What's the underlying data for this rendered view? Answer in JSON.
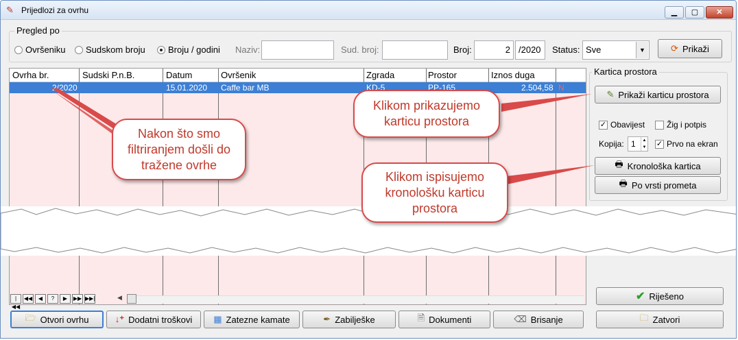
{
  "window": {
    "title": "Prijedlozi za ovrhu",
    "min_label": "▁",
    "max_label": "▢",
    "close_label": "✕"
  },
  "filter": {
    "legend": "Pregled po",
    "radios": [
      {
        "label": "Ovršeniku",
        "selected": false
      },
      {
        "label": "Sudskom broju",
        "selected": false
      },
      {
        "label": "Broju / godini",
        "selected": true
      }
    ],
    "naziv_label": "Naziv:",
    "naziv_value": "",
    "sud_broj_label": "Sud. broj:",
    "sud_broj_value": "",
    "broj_label": "Broj:",
    "broj_value": "2",
    "godina_value": "/2020",
    "status_label": "Status:",
    "status_value": "Sve",
    "prikazi_label": "Prikaži"
  },
  "grid": {
    "columns": [
      "Ovrha br.",
      "Sudski P.n.B.",
      "Datum",
      "Ovršenik",
      "Zgrada",
      "Prostor",
      "Iznos duga"
    ],
    "rows": [
      {
        "ovrha": "2/2020",
        "sudski": "",
        "datum": "15.01.2020",
        "ovrsenik": "Caffe bar  MB",
        "zgrada": "KD-5",
        "prostor": "PP-165",
        "iznos": "2.504,58",
        "flag": "N"
      }
    ]
  },
  "kartica": {
    "legend": "Kartica prostora",
    "prikazi_karticu_label": "Prikaži karticu prostora",
    "obavijest_label": "Obavijest",
    "obavijest_checked": true,
    "zig_label": "Žig i potpis",
    "zig_checked": false,
    "kopija_label": "Kopija:",
    "kopija_value": "1",
    "prvo_label": "Prvo na ekran",
    "prvo_checked": true,
    "kronoloska_label": "Kronološka kartica",
    "po_vrsti_label": "Po vrsti prometa"
  },
  "bottom": {
    "rijeseno_label": "Riješeno",
    "zatvori_label": "Zatvori",
    "buttons": [
      {
        "label": "Otvori ovrhu",
        "icon": "folder-open-icon"
      },
      {
        "label": "Dodatni troškovi",
        "icon": "down-plus-icon"
      },
      {
        "label": "Zatezne kamate",
        "icon": "calculator-icon"
      },
      {
        "label": "Zabilješke",
        "icon": "pen-icon"
      },
      {
        "label": "Dokumenti",
        "icon": "document-icon"
      },
      {
        "label": "Brisanje",
        "icon": "eraser-icon"
      }
    ]
  },
  "callouts": {
    "filter_note": "Nakon što smo filtriranjem došli do tražene ovrhe",
    "kartica_note": "Klikom prikazujemo karticu prostora",
    "kronoloska_note": "Klikom ispisujemo kronološku karticu prostora"
  },
  "colors": {
    "selection": "#3c7fd5",
    "grid_bg": "#fde9ea",
    "callout_border": "#d94a4a",
    "callout_text": "#c0392b",
    "check_green": "#2e9e2e"
  }
}
